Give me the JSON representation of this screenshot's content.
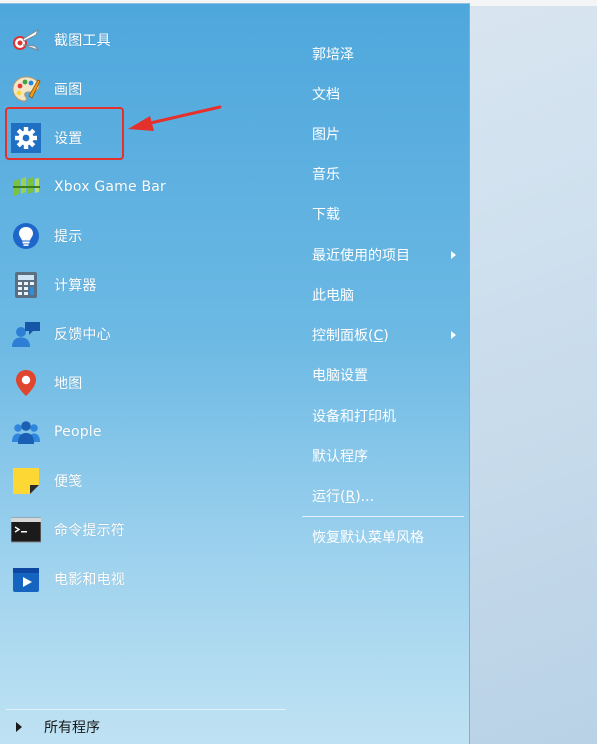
{
  "start_menu": {
    "apps": [
      {
        "label": "截图工具",
        "icon": "snipping-tool-icon"
      },
      {
        "label": "画图",
        "icon": "paint-palette-icon"
      },
      {
        "label": "设置",
        "icon": "gear-icon"
      },
      {
        "label": "Xbox Game Bar",
        "icon": "xbox-game-bar-icon"
      },
      {
        "label": "提示",
        "icon": "tips-lightbulb-icon"
      },
      {
        "label": "计算器",
        "icon": "calculator-icon"
      },
      {
        "label": "反馈中心",
        "icon": "feedback-hub-icon"
      },
      {
        "label": "地图",
        "icon": "map-pin-icon"
      },
      {
        "label": "People",
        "icon": "people-icon"
      },
      {
        "label": "便笺",
        "icon": "sticky-notes-icon"
      },
      {
        "label": "命令提示符",
        "icon": "command-prompt-icon"
      },
      {
        "label": "电影和电视",
        "icon": "movies-tv-icon"
      }
    ],
    "all_programs": "所有程序",
    "places": [
      {
        "label": "郭培泽"
      },
      {
        "label": "文档"
      },
      {
        "label": "图片"
      },
      {
        "label": "音乐"
      },
      {
        "label": "下载"
      },
      {
        "label": "最近使用的项目",
        "submenu": true
      },
      {
        "label": "此电脑"
      },
      {
        "label": "控制面板",
        "accel": "C",
        "submenu": true
      },
      {
        "label": "电脑设置"
      },
      {
        "label": "设备和打印机"
      },
      {
        "label": "默认程序"
      },
      {
        "label": "运行",
        "accel": "R",
        "suffix": "..."
      },
      {
        "label": "恢复默认菜单风格"
      }
    ]
  },
  "colors": {
    "menu_top": "#4ea7dc",
    "menu_bottom": "#bfe2f3",
    "highlight": "#e4312c"
  }
}
